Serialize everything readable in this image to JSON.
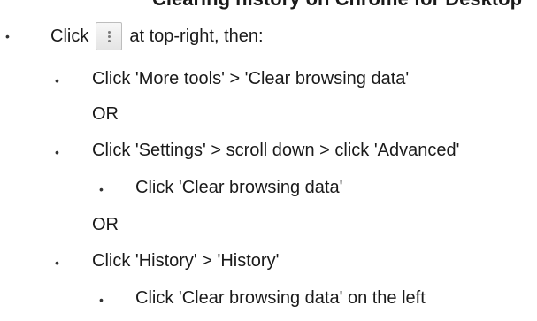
{
  "heading_fragment": "Clearing history on Chrome for Desktop",
  "intro": {
    "click_word": "Click",
    "after_icon": "at top-right, then:"
  },
  "icon": "kebab-menu-icon",
  "option1": "Click 'More tools' > 'Clear browsing data'",
  "or1": "OR",
  "option2": "Click 'Settings' > scroll down > click 'Advanced'",
  "option2_sub": "Click 'Clear browsing data'",
  "or2": "OR",
  "option3": "Click 'History' > 'History'",
  "option3_sub": "Click 'Clear browsing data' on the left"
}
